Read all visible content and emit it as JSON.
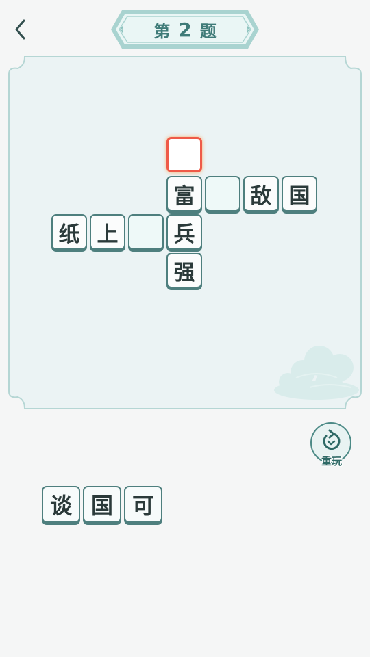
{
  "header": {
    "title_prefix": "第",
    "level_number": "2",
    "title_suffix": "题"
  },
  "board": {
    "cells": [
      {
        "char": "",
        "state": "selected"
      },
      {
        "char": "富",
        "state": "filled"
      },
      {
        "char": "",
        "state": "empty"
      },
      {
        "char": "敌",
        "state": "filled"
      },
      {
        "char": "国",
        "state": "filled"
      },
      {
        "char": "纸",
        "state": "filled"
      },
      {
        "char": "上",
        "state": "filled"
      },
      {
        "char": "",
        "state": "empty"
      },
      {
        "char": "兵",
        "state": "filled"
      },
      {
        "char": "强",
        "state": "filled"
      }
    ]
  },
  "controls": {
    "reset_label": "重玩"
  },
  "choices": [
    "谈",
    "国",
    "可"
  ],
  "colors": {
    "accent": "#4e7f7e",
    "board_bg": "#ebf3f4",
    "board_border": "#b5d6d4",
    "selected_border": "#ef5a48",
    "page_bg": "#f5f6f6"
  }
}
